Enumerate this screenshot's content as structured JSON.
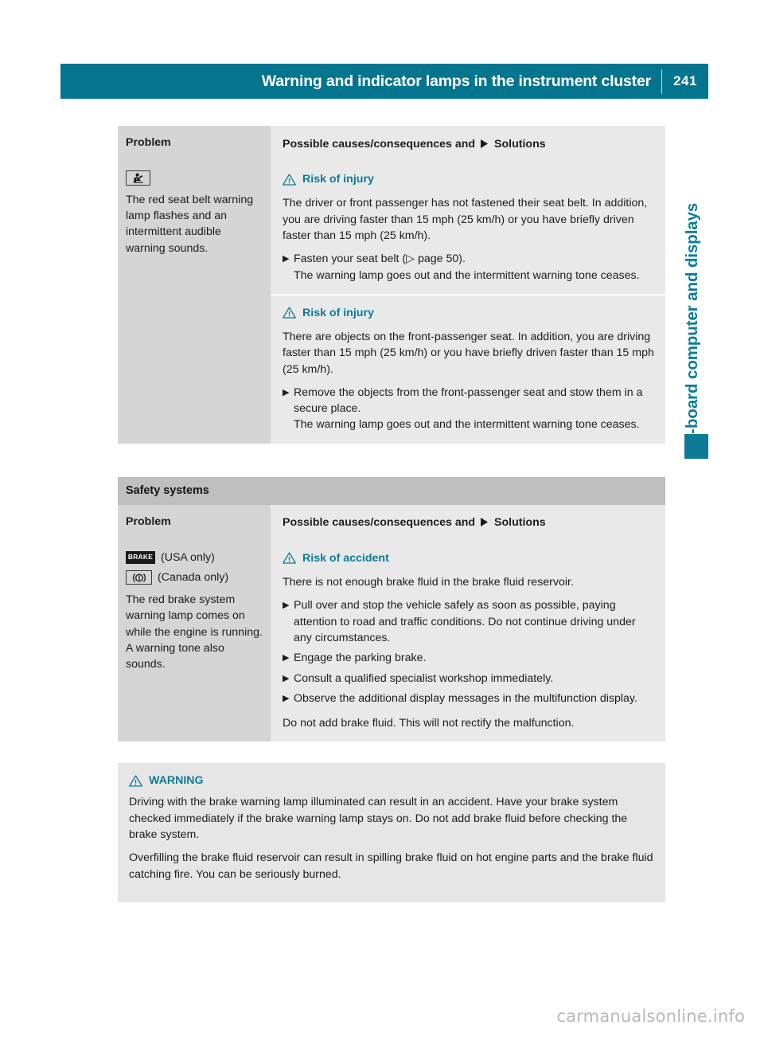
{
  "header": {
    "title": "Warning and indicator lamps in the instrument cluster",
    "page_number": "241",
    "bar_color": "#05758f"
  },
  "side_tab": {
    "label": "On-board computer and displays",
    "color": "#0b7c97"
  },
  "table1": {
    "columns": {
      "problem": "Problem",
      "solutions_prefix": "Possible causes/consequences and",
      "solutions_suffix": "Solutions"
    },
    "row": {
      "problem_icon": "seat-belt-warning-lamp-icon",
      "problem_text": "The red seat belt warning lamp flashes and an intermittent audible warning sounds.",
      "blocks": [
        {
          "risk_title": "Risk of injury",
          "risk_color": "#0b7c97",
          "cause": "The driver or front passenger has not fastened their seat belt. In addition, you are driving faster than 15 mph (25 km/h) or you have briefly driven faster than 15 mph (25 km/h).",
          "steps": [
            {
              "action": "Fasten your seat belt (▷ page 50).",
              "result": "The warning lamp goes out and the intermittent warning tone ceases."
            }
          ]
        },
        {
          "risk_title": "Risk of injury",
          "risk_color": "#0b7c97",
          "cause": "There are objects on the front-passenger seat. In addition, you are driving faster than 15 mph (25 km/h) or you have briefly driven faster than 15 mph (25 km/h).",
          "steps": [
            {
              "action": "Remove the objects from the front-passenger seat and stow them in a secure place.",
              "result": "The warning lamp goes out and the intermittent warning tone ceases."
            }
          ]
        }
      ]
    }
  },
  "section2": {
    "heading": "Safety systems",
    "columns": {
      "problem": "Problem",
      "solutions_prefix": "Possible causes/consequences and",
      "solutions_suffix": "Solutions"
    },
    "row": {
      "icons": [
        {
          "name": "brake-warning-lamp-icon",
          "glyph": "BRAKE",
          "label": "(USA only)"
        },
        {
          "name": "brake-warning-lamp-canada-icon",
          "glyph": "(!)",
          "label": "(Canada only)"
        }
      ],
      "problem_text": "The red brake system warning lamp comes on while the engine is running. A warning tone also sounds.",
      "risk_title": "Risk of accident",
      "risk_color": "#0b7c97",
      "cause": "There is not enough brake fluid in the brake fluid reservoir.",
      "steps": [
        {
          "action": "Pull over and stop the vehicle safely as soon as possible, paying attention to road and traffic conditions. Do not continue driving under any circumstances.",
          "result": ""
        },
        {
          "action": "Engage the parking brake.",
          "result": ""
        },
        {
          "action": "Consult a qualified specialist workshop immediately.",
          "result": ""
        },
        {
          "action": "Observe the additional display messages in the multifunction display.",
          "result": ""
        }
      ],
      "closing": "Do not add brake fluid. This will not rectify the malfunction."
    }
  },
  "warning_box": {
    "title": "WARNING",
    "title_color": "#0b7c97",
    "paragraphs": [
      "Driving with the brake warning lamp illuminated can result in an accident. Have your brake system checked immediately if the brake warning lamp stays on. Do not add brake fluid before checking the brake system.",
      "Overfilling the brake fluid reservoir can result in spilling brake fluid on hot engine parts and the brake fluid catching fire. You can be seriously burned."
    ]
  },
  "footer": {
    "watermark": "carmanualsonline.info"
  }
}
